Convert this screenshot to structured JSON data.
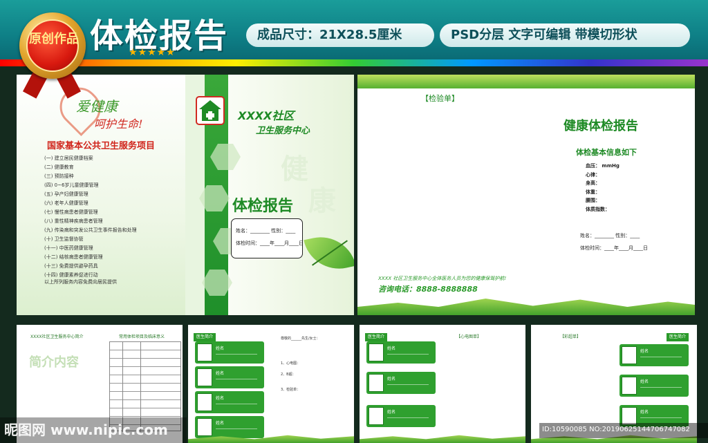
{
  "header": {
    "title": "体检报告",
    "size_label": "成品尺寸：21X28.5厘米",
    "features_label": "PSD分层 文字可编辑 带模切形状",
    "badge_text": "原创作品",
    "stars": "★★★★★"
  },
  "cover_back": {
    "slogan_line1": "爱健康",
    "slogan_line2": "呵护生命!",
    "services_title": "国家基本公共卫生服务项目",
    "services": [
      "(一) 建立居民健康档案",
      "(二) 健康教育",
      "(三) 预防接种",
      "(四) 0~6岁儿童健康管理",
      "(五) 孕产妇健康管理",
      "(六) 老年人健康管理",
      "(七) 慢性病患者健康管理",
      "(八) 重性精神疾病患者管理",
      "(九) 传染病和突发公共卫生事件报告和处理",
      "(十) 卫生监督协管",
      "(十一) 中医药健康管理",
      "(十二) 结核病患者健康管理",
      "(十三) 免费提供避孕药具",
      "(十四) 健康素养促进行动"
    ],
    "services_footer": "以上所列服务内容免费向居民提供"
  },
  "cover_front": {
    "org_line1": "XXXX社区",
    "org_line2": "卫生服务中心",
    "title": "体检报告",
    "watermark1": "健",
    "watermark2": "康",
    "form_name": "姓名：________ 性别：____",
    "form_date": "体检时间：____年____月____日"
  },
  "report_page": {
    "tab": "【检验单】",
    "title": "健康体检报告",
    "subtitle": "体检基本信息如下",
    "fields": [
      "血压：          mmHg",
      "心律：",
      "身高：",
      "体重：",
      "腰围：",
      "体质指数："
    ],
    "form_name": "姓名：________ 性别：____",
    "form_date": "体检时间：____年____月____日",
    "note": "XXXX 社区卫生服务中心全体医务人员为您的健康保驾护航!",
    "phone": "咨询电话：8888-8888888"
  },
  "intro_page": {
    "header_left": "XXXX社区卫生服务中心简介",
    "header_right": "常用体检项目及临床意义",
    "big_text": "简介内容"
  },
  "doc_pages": {
    "doctor_tag": "医生简介",
    "ecg_tag": "【心电图单】",
    "xray_tag": "【彩超单】",
    "card_name": "姓名",
    "lines": [
      "尊敬的______先生/女士：",
      "1、心电图：",
      "2、B超：",
      "3、检验单："
    ]
  },
  "watermarks": {
    "site": "昵图网 www.nipic.com",
    "id": "ID:10590085 NO:20190625144706747082"
  },
  "colors": {
    "primary_green": "#2fa02f",
    "banner_teal": "#0e7f86",
    "accent_red": "#d0241b"
  }
}
